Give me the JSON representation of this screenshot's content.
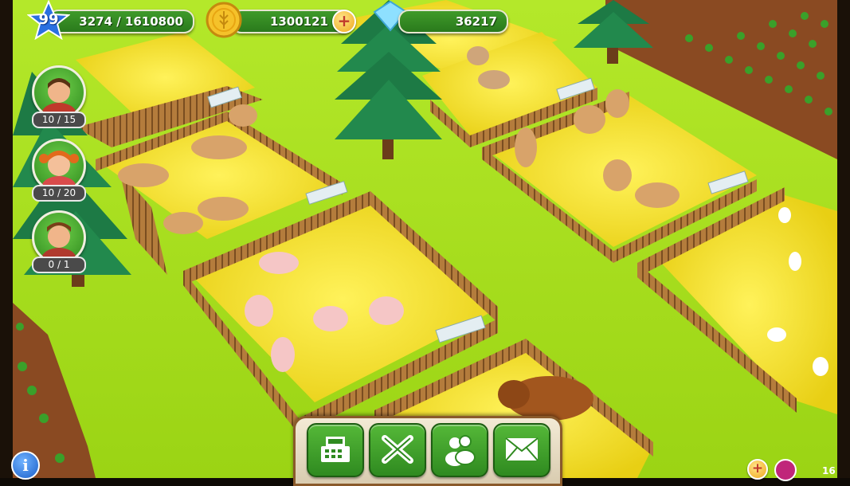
{
  "hud": {
    "level": "99",
    "xp_text": "3274 / 1610800",
    "coins": "1300121",
    "diamonds": "36217"
  },
  "workers": [
    {
      "name": "farmer",
      "count": "10 / 15"
    },
    {
      "name": "girl",
      "count": "10 / 20"
    },
    {
      "name": "helper",
      "count": "0 / 1"
    }
  ],
  "toolbar": {
    "items": [
      "shop",
      "build",
      "friends",
      "mail"
    ]
  },
  "footer": {
    "counter": "16"
  },
  "colors": {
    "grass": "#a8e01a",
    "hay": "#f3e21c",
    "fence": "#b07a3a",
    "hud_green": "#3f9a2a",
    "tree": "#1f8a4a"
  },
  "icons": [
    "star-icon",
    "coin-icon",
    "plus-icon",
    "diamond-icon",
    "cash-register-icon",
    "cross-tools-icon",
    "people-icon",
    "envelope-icon",
    "info-icon",
    "crown-icon"
  ]
}
